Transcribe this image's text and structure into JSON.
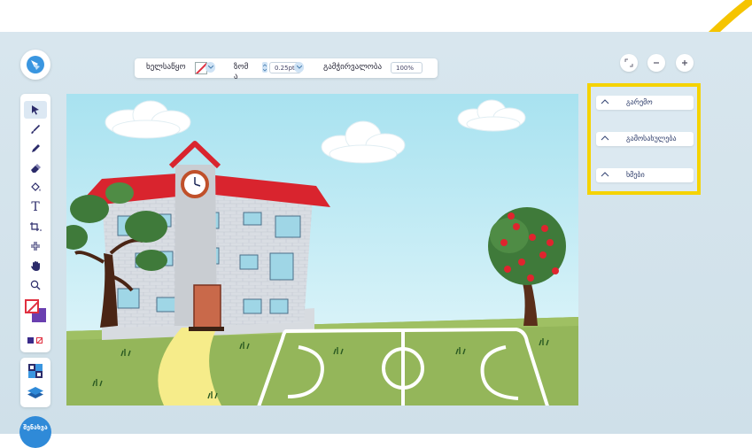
{
  "toolbar": {
    "stroke_label": "ხელსაწყო",
    "size_label": "ზომა",
    "size_value": "0.25pt",
    "opacity_label": "გამჭირვალობა",
    "opacity_value": "100%"
  },
  "tools": [
    {
      "name": "select-tool",
      "icon": "cursor-arrow-icon"
    },
    {
      "name": "brush-tool",
      "icon": "brush-icon"
    },
    {
      "name": "pencil-tool",
      "icon": "pencil-icon"
    },
    {
      "name": "eraser-tool",
      "icon": "eraser-icon"
    },
    {
      "name": "fill-tool",
      "icon": "paint-bucket-icon"
    },
    {
      "name": "text-tool",
      "icon": "text-t-icon",
      "glyph": "T"
    },
    {
      "name": "crop-tool",
      "icon": "crop-icon"
    },
    {
      "name": "shrink-tool",
      "icon": "shrink-arrows-icon"
    },
    {
      "name": "hand-tool",
      "icon": "hand-icon"
    },
    {
      "name": "zoom-tool",
      "icon": "magnifier-icon"
    }
  ],
  "user": {
    "label": "შენახვა"
  },
  "panels": [
    {
      "label": "გარემო"
    },
    {
      "label": "გამოსახულება"
    },
    {
      "label": "ხმები"
    }
  ],
  "colors": {
    "highlight": "#f5d300",
    "accent": "#2f8ad8",
    "primary_fill": "#6a3fb0",
    "stroke_none": "#e03040"
  }
}
